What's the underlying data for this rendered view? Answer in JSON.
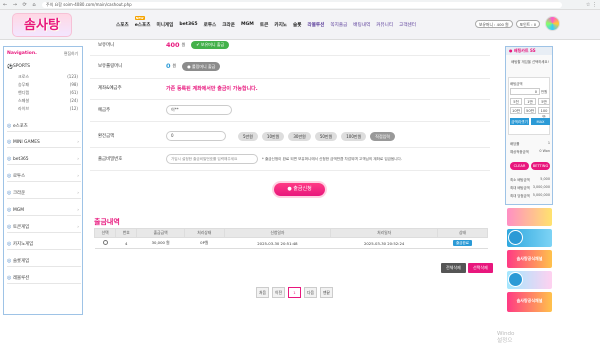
{
  "browser": {
    "nav": "←  →  ⟳  ⌂",
    "security": "주의 요함",
    "url": "soim-4080.com/main/cashout.php",
    "menu": "☆  ⋮"
  },
  "header": {
    "logo": "솜사탕",
    "menu": [
      "스포츠",
      "e스포츠",
      "미니게임",
      "bet365",
      "로투스",
      "크라운",
      "MGM",
      "토큰",
      "카지노",
      "슬롯",
      "라볼루션",
      "쪽지출금",
      "배팅내역",
      "커뮤니티",
      "고객센터"
    ],
    "hot_badge": "NEW",
    "user_level": "보유머니 : 400 원",
    "user_point": "포인트 : 0"
  },
  "sidebar": {
    "title": "Navigation.",
    "edit": "편집하기",
    "sports_label": "SPORTS",
    "sports_sub": [
      {
        "name": "크로스",
        "count": "(123)"
      },
      {
        "name": "승무패",
        "count": "(98)"
      },
      {
        "name": "핸디캡",
        "count": "(61)"
      },
      {
        "name": "스페셜",
        "count": "(24)"
      },
      {
        "name": "라이브",
        "count": "(12)"
      }
    ],
    "items": [
      "e스포츠",
      "MINI GAMES",
      "bet365",
      "로투스",
      "크라운",
      "MGM",
      "토큰게임",
      "카지노게임",
      "슬롯게임",
      "레볼루션"
    ]
  },
  "form": {
    "money_label": "보유머니",
    "money_value": "400",
    "won": "원",
    "money_btn": "보유머니 출금",
    "point_label": "보유롤링머니",
    "point_value": "0",
    "point_unit": "원",
    "point_btn": "롤링머니 출금",
    "account_label": "계좌&예금주",
    "account_msg": "가존 등록된 계좌에서만 출금이 가능합니다.",
    "holder_label": "예금주",
    "holder_value": "이**",
    "amount_label": "환전금액",
    "amount_value": "0",
    "amount_chips": [
      "5만원",
      "10만원",
      "30만원",
      "50만원",
      "100만원",
      "직접입력"
    ],
    "pw_label": "출금비밀번호",
    "pw_placeholder": "가입시 설정한 출금비밀번호를 입력해주세요",
    "pw_note": "* 출금신청이 완료 되면 보유머니에서 신청한 금액만큼 차감되며 고객님의 계좌로 입금됩니다.",
    "submit": "● 출금신청"
  },
  "history": {
    "title": "출금내역",
    "columns": [
      "선택",
      "번호",
      "출금금액",
      "처리상태",
      "신청일자",
      "처리일자",
      "상태"
    ],
    "rows": [
      {
        "no": "4",
        "amount": "30,000 원",
        "status": "0P원",
        "req": "2025-03-30 20:51:48",
        "done": "2025-03-30 20:52:24",
        "state": "출금완료"
      }
    ],
    "delete_all": "전체삭제",
    "delete_sel": "선택삭제",
    "pager": [
      "처음",
      "이전",
      "1",
      "다음",
      "맨끝"
    ]
  },
  "watermark": [
    "Windo",
    "설정으"
  ],
  "rpanel": {
    "title": "● 배팅카트 SS",
    "subtitle": "배팅할 게임을 선택하세요!",
    "bet_label": "배팅금액",
    "bet_value": "0",
    "bet_unit": "만원",
    "quick": [
      "5천",
      "1만",
      "5만",
      "10만",
      "50만",
      "100만"
    ],
    "reset": "금액리셋기",
    "max": "MAX",
    "stats": [
      {
        "k": "배당률",
        "v": "1"
      },
      {
        "k": "예상적중금액",
        "v": "0 Won"
      },
      {
        "k": "최소 배팅금액",
        "v": "5,000"
      },
      {
        "k": "최대 배팅금액",
        "v": "3,000,000"
      },
      {
        "k": "최대 당첨금액",
        "v": "5,000,000"
      }
    ],
    "clear": "CLEAR",
    "betting": "BETTING"
  },
  "ads": [
    "솜사탕공식채널",
    "솜사탕공식채널"
  ],
  "colors": {
    "brand": "#e8177d",
    "accent_blue": "#2b9ad6",
    "green": "#43b14a"
  }
}
